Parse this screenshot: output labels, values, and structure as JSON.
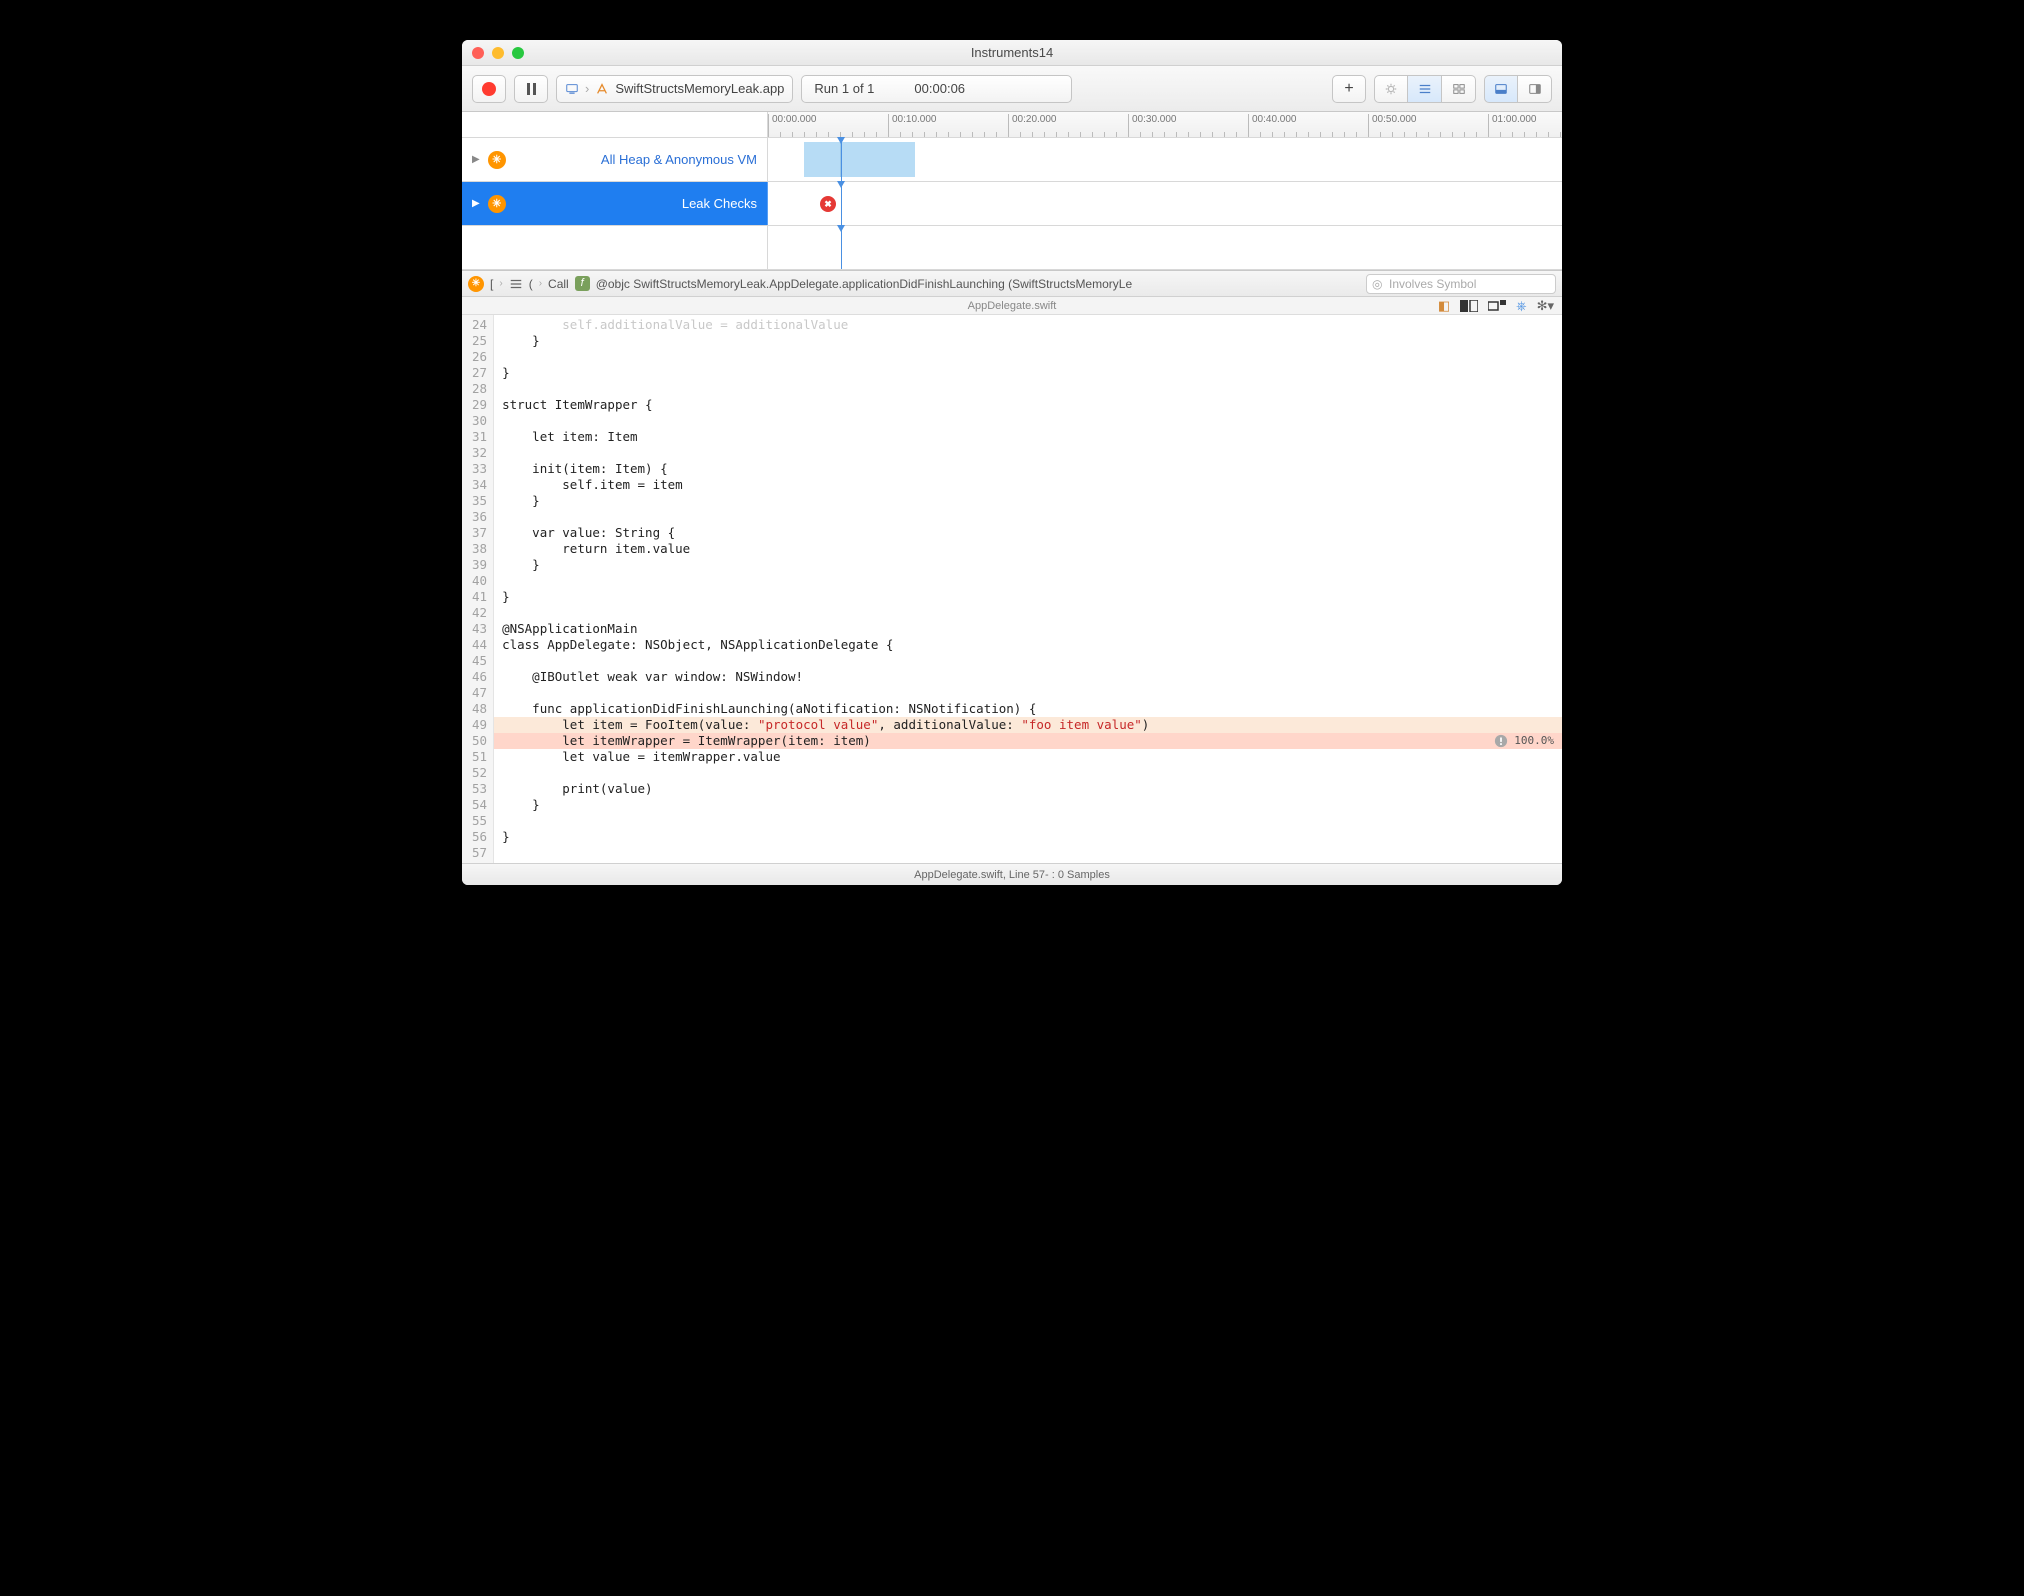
{
  "window": {
    "title": "Instruments14"
  },
  "toolbar": {
    "target_app": "SwiftStructsMemoryLeak.app",
    "run_label": "Run 1 of 1",
    "elapsed": "00:00:06"
  },
  "timeline": {
    "ticks": [
      "00:00.000",
      "00:10.000",
      "00:20.000",
      "00:30.000",
      "00:40.000",
      "00:50.000",
      "01:00.000"
    ],
    "tracks": [
      {
        "name": "All Heap & Anonymous VM",
        "selected": false
      },
      {
        "name": "Leak Checks",
        "selected": true
      }
    ]
  },
  "subtoolbar": {
    "mode": "Call",
    "breadcrumb_icon_label": "f",
    "breadcrumb": "@objc SwiftStructsMemoryLeak.AppDelegate.applicationDidFinishLaunching (SwiftStructsMemoryLe",
    "search_placeholder": "Involves Symbol"
  },
  "file": {
    "name": "AppDelegate.swift"
  },
  "annotations": {
    "line50_percent": "100.0%"
  },
  "code": {
    "first_line": 24,
    "lines": [
      {
        "n": 24,
        "t": "        self.additionalValue = additionalValue",
        "dim": true
      },
      {
        "n": 25,
        "t": "    }"
      },
      {
        "n": 26,
        "t": ""
      },
      {
        "n": 27,
        "t": "}"
      },
      {
        "n": 28,
        "t": ""
      },
      {
        "n": 29,
        "t": "struct ItemWrapper {"
      },
      {
        "n": 30,
        "t": ""
      },
      {
        "n": 31,
        "t": "    let item: Item"
      },
      {
        "n": 32,
        "t": ""
      },
      {
        "n": 33,
        "t": "    init(item: Item) {"
      },
      {
        "n": 34,
        "t": "        self.item = item"
      },
      {
        "n": 35,
        "t": "    }"
      },
      {
        "n": 36,
        "t": ""
      },
      {
        "n": 37,
        "t": "    var value: String {"
      },
      {
        "n": 38,
        "t": "        return item.value"
      },
      {
        "n": 39,
        "t": "    }"
      },
      {
        "n": 40,
        "t": ""
      },
      {
        "n": 41,
        "t": "}"
      },
      {
        "n": 42,
        "t": ""
      },
      {
        "n": 43,
        "t": "@NSApplicationMain"
      },
      {
        "n": 44,
        "t": "class AppDelegate: NSObject, NSApplicationDelegate {"
      },
      {
        "n": 45,
        "t": ""
      },
      {
        "n": 46,
        "t": "    @IBOutlet weak var window: NSWindow!"
      },
      {
        "n": 47,
        "t": ""
      },
      {
        "n": 48,
        "t": "    func applicationDidFinishLaunching(aNotification: NSNotification) {"
      },
      {
        "n": 49,
        "html": "        let item = FooItem(value: <span class='str'>\"protocol value\"</span>, additionalValue: <span class='str'>\"foo item value\"</span>)",
        "hl": "tan"
      },
      {
        "n": 50,
        "t": "        let itemWrapper = ItemWrapper(item: item)",
        "hl": "pink",
        "badge": true
      },
      {
        "n": 51,
        "t": "        let value = itemWrapper.value"
      },
      {
        "n": 52,
        "t": ""
      },
      {
        "n": 53,
        "t": "        print(value)"
      },
      {
        "n": 54,
        "t": "    }"
      },
      {
        "n": 55,
        "t": ""
      },
      {
        "n": 56,
        "t": "}"
      },
      {
        "n": 57,
        "t": ""
      }
    ]
  },
  "status": "AppDelegate.swift, Line 57- : 0 Samples"
}
